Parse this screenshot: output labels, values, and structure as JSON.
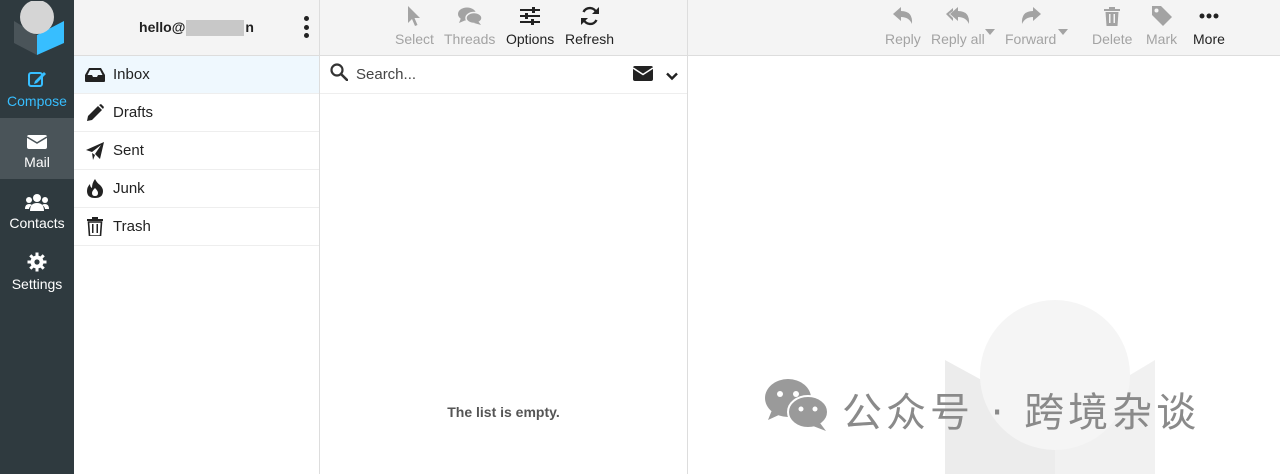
{
  "account": {
    "prefix": "hello@",
    "suffix": "n"
  },
  "rail": {
    "compose": "Compose",
    "mail": "Mail",
    "contacts": "Contacts",
    "settings": "Settings"
  },
  "folders": [
    {
      "label": "Inbox",
      "icon": "inbox-icon"
    },
    {
      "label": "Drafts",
      "icon": "pencil-icon"
    },
    {
      "label": "Sent",
      "icon": "paper-plane-icon"
    },
    {
      "label": "Junk",
      "icon": "fire-icon"
    },
    {
      "label": "Trash",
      "icon": "trash-icon"
    }
  ],
  "list_toolbar": {
    "select": "Select",
    "threads": "Threads",
    "options": "Options",
    "refresh": "Refresh"
  },
  "search": {
    "placeholder": "Search..."
  },
  "list": {
    "empty_text": "The list is empty."
  },
  "preview_toolbar": {
    "reply": "Reply",
    "reply_all": "Reply all",
    "forward": "Forward",
    "delete": "Delete",
    "mark": "Mark",
    "more": "More"
  },
  "watermark": {
    "text": "公众号 · 跨境杂谈"
  },
  "colors": {
    "rail_bg": "#2f3a3f",
    "rail_active": "#4a5459",
    "accent": "#37beff",
    "folder_active": "#eff8fe",
    "toolbar_bg": "#f4f4f4"
  }
}
